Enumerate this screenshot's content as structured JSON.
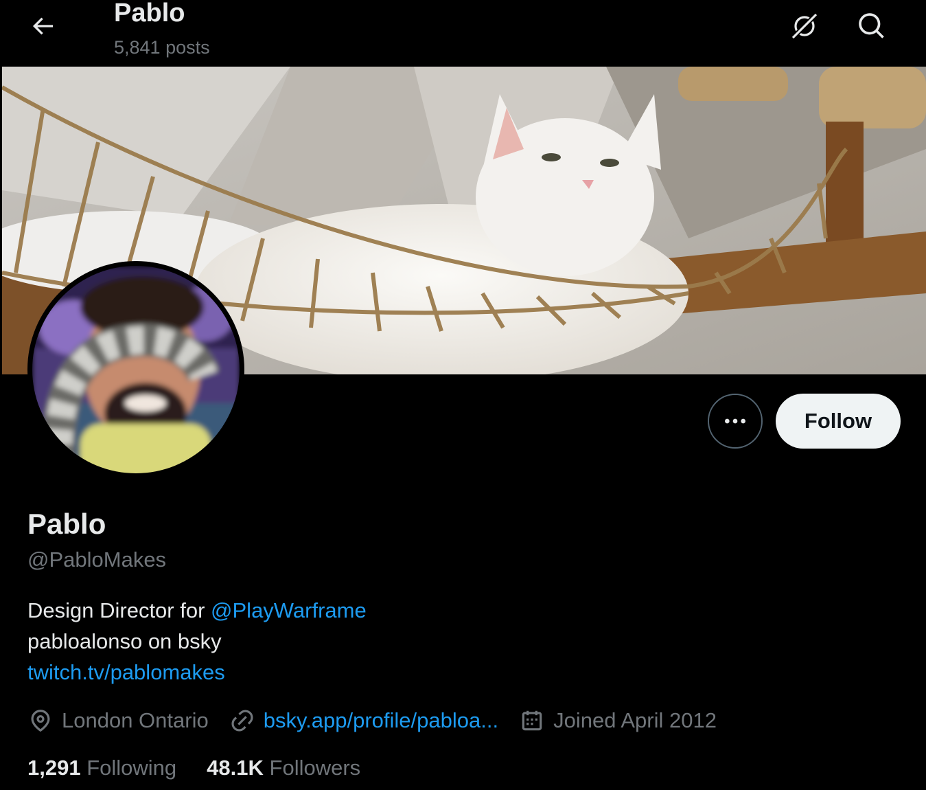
{
  "header": {
    "name": "Pablo",
    "posts": "5,841 posts",
    "back_icon": "arrow-left-icon",
    "grok_icon": "grok-icon",
    "search_icon": "search-icon"
  },
  "profile": {
    "display_name": "Pablo",
    "handle": "@PabloMakes",
    "bio": {
      "line1_prefix": "Design Director for ",
      "line1_mention": "@PlayWarframe",
      "line2": "pabloalonso on bsky",
      "line3_link": "twitch.tv/pablomakes"
    },
    "location": "London Ontario",
    "website": "bsky.app/profile/pabloa...",
    "joined": "Joined April 2012",
    "following_count": "1,291",
    "following_label": "Following",
    "followers_count": "48.1K",
    "followers_label": "Followers"
  },
  "actions": {
    "follow_label": "Follow",
    "more_icon": "more-dots-icon"
  },
  "colors": {
    "background": "#000000",
    "text_primary": "#e7e9ea",
    "text_secondary": "#71767b",
    "link": "#1d9bf0",
    "follow_bg": "#eff3f4"
  }
}
